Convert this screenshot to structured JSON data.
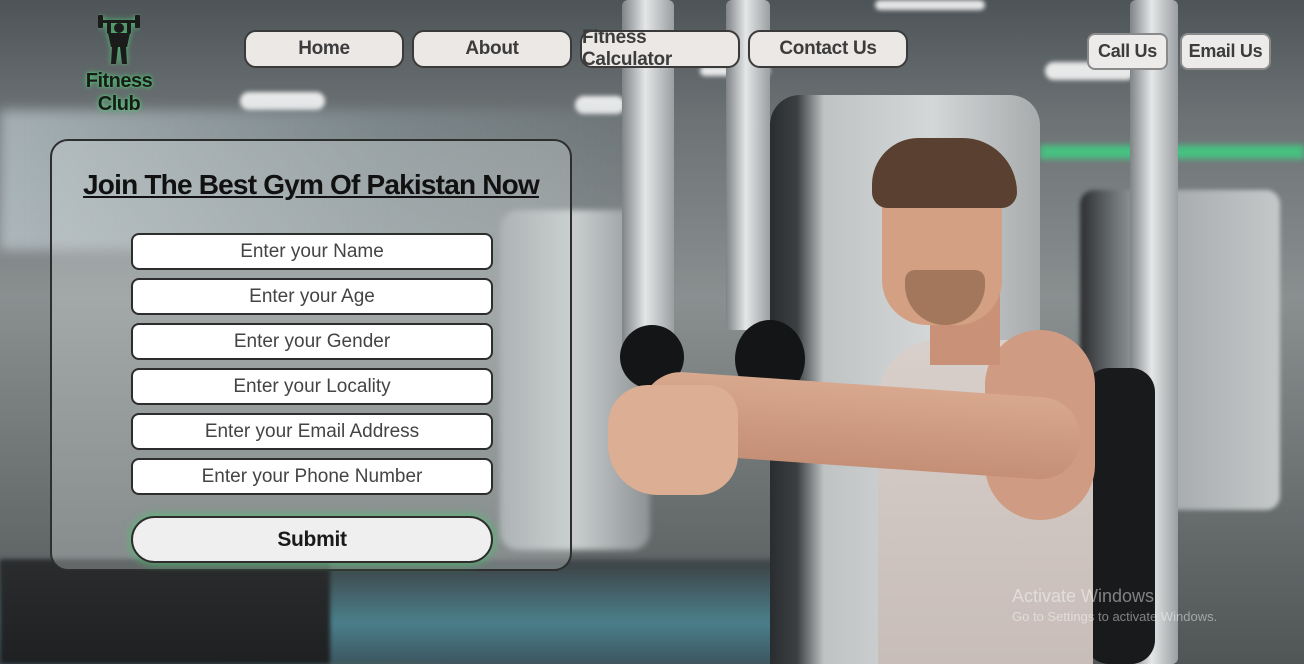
{
  "brand": {
    "name": "Fitness Club",
    "logo_icon": "bodybuilder-dumbbell-icon"
  },
  "nav": {
    "items": [
      {
        "label": "Home"
      },
      {
        "label": "About"
      },
      {
        "label": "Fitness Calculator"
      },
      {
        "label": "Contact Us"
      }
    ]
  },
  "cta": {
    "call_label": "Call Us",
    "email_label": "Email Us"
  },
  "form": {
    "title": "Join The Best Gym Of Pakistan Now",
    "fields": [
      {
        "placeholder": "Enter your Name",
        "value": ""
      },
      {
        "placeholder": "Enter your Age",
        "value": ""
      },
      {
        "placeholder": "Enter your Gender",
        "value": ""
      },
      {
        "placeholder": "Enter your Locality",
        "value": ""
      },
      {
        "placeholder": "Enter your Email Address",
        "value": ""
      },
      {
        "placeholder": "Enter your Phone Number",
        "value": ""
      }
    ],
    "submit_label": "Submit"
  },
  "os_watermark": {
    "title": "Activate Windows",
    "subtitle": "Go to Settings to activate Windows."
  },
  "colors": {
    "glow_accent": "#50d278",
    "button_bg": "#ece8e6",
    "button_border": "#3a3a3a"
  }
}
